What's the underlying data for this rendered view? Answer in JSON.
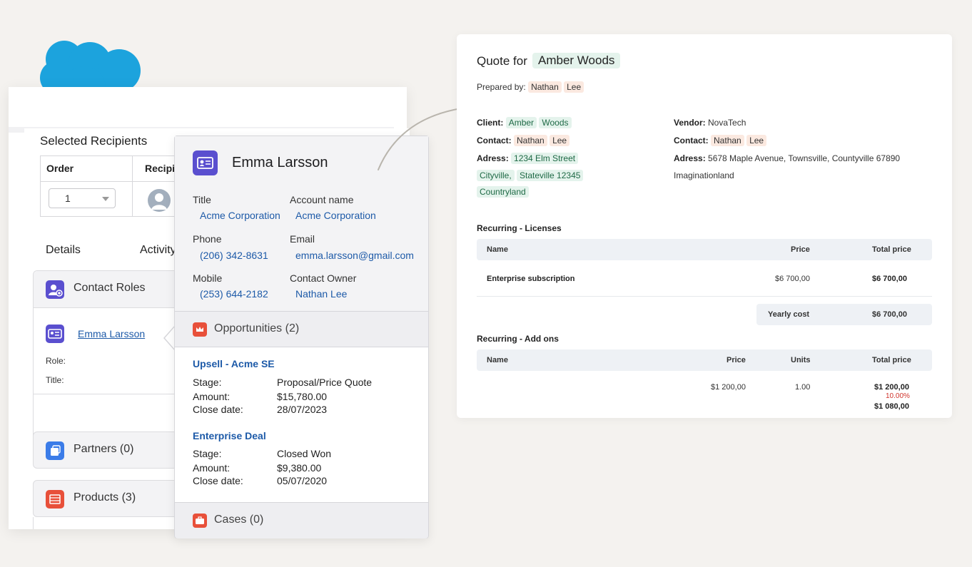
{
  "recipients": {
    "title": "Selected Recipients",
    "col_order": "Order",
    "col_recipient": "Recipi",
    "order_value": "1"
  },
  "tabs": {
    "details": "Details",
    "activity": "Activity"
  },
  "contact_roles": {
    "title": "Contact Roles",
    "contact_name": "Emma Larsson",
    "role_label": "Role:",
    "title_label": "Title:"
  },
  "partners": {
    "title": "Partners (0)"
  },
  "products": {
    "title": "Products (3)"
  },
  "contact_card": {
    "name": "Emma Larsson",
    "title_label": "Title",
    "title_value": "Acme Corporation",
    "account_label": "Account name",
    "account_value": "Acme Corporation",
    "phone_label": "Phone",
    "phone_value": "(206) 342-8631",
    "email_label": "Email",
    "email_value": "emma.larsson@gmail.com",
    "mobile_label": "Mobile",
    "mobile_value": "(253) 644-2182",
    "owner_label": "Contact Owner",
    "owner_value": "Nathan Lee",
    "opportunities_title": "Opportunities (2)",
    "opportunities": [
      {
        "name": "Upsell - Acme SE",
        "stage_label": "Stage:",
        "stage": "Proposal/Price Quote",
        "amount_label": "Amount:",
        "amount": "$15,780.00",
        "close_label": "Close date:",
        "close": "28/07/2023"
      },
      {
        "name": "Enterprise Deal",
        "stage_label": "Stage:",
        "stage": "Closed Won",
        "amount_label": "Amount:",
        "amount": "$9,380.00",
        "close_label": "Close date:",
        "close": "05/07/2020"
      }
    ],
    "cases_title": "Cases (0)"
  },
  "quote": {
    "title_prefix": "Quote for",
    "customer": "Amber Woods",
    "prepared_label": "Prepared by:",
    "prepared_first": "Nathan",
    "prepared_last": "Lee",
    "client_label": "Client:",
    "client_first": "Amber",
    "client_last": "Woods",
    "contact_label": "Contact:",
    "contact_first": "Nathan",
    "contact_last": "Lee",
    "address_label": "Adress:",
    "client_address_1": "1234 Elm Street",
    "client_city": "Cityville,",
    "client_state": "Stateville 12345",
    "client_country": "Countryland",
    "vendor_label": "Vendor:",
    "vendor_name": "NovaTech",
    "vendor_contact_first": "Nathan",
    "vendor_contact_last": "Lee",
    "vendor_address": "5678 Maple Avenue, Townsville, Countyville 67890",
    "vendor_country": "Imaginationland",
    "licenses_title": "Recurring - Licenses",
    "col_name": "Name",
    "col_price": "Price",
    "col_units": "Units",
    "col_total": "Total price",
    "license_item": "Enterprise subscription",
    "license_price": "$6 700,00",
    "license_total": "$6 700,00",
    "yearly_label": "Yearly cost",
    "yearly_value": "$6 700,00",
    "addons_title": "Recurring - Add ons",
    "addon_price": "$1 200,00",
    "addon_units": "1.00",
    "addon_total": "$1 200,00",
    "addon_discount": "10.00%",
    "addon_final": "$1 080,00"
  },
  "colors": {
    "salesforce_blue": "#1ca3dd",
    "link_blue": "#1d5aa8",
    "contact_icon": "#5a4fcf",
    "opportunity_icon": "#e8503a",
    "partners_icon": "#3b7ce8",
    "highlight_green": "#e4f3ec",
    "highlight_orange": "#fbe9e0",
    "discount_red": "#d0342c"
  }
}
